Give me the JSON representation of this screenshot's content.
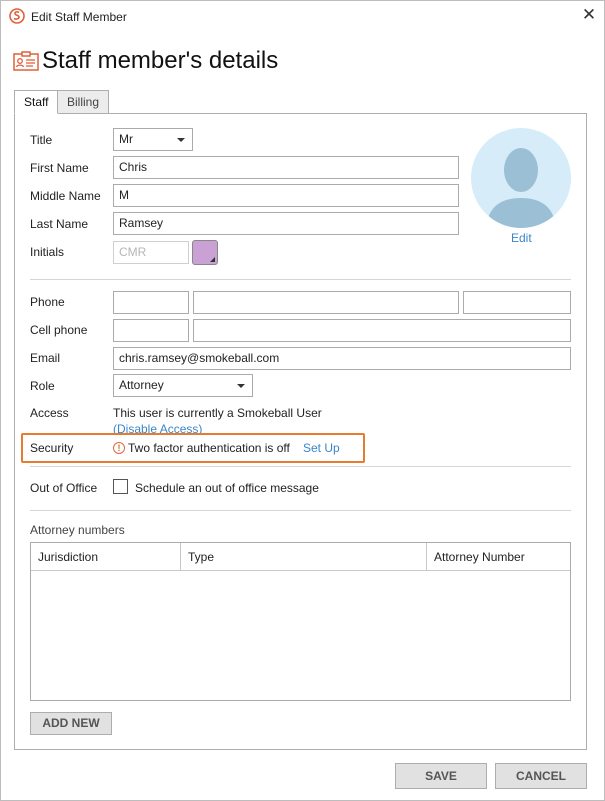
{
  "window": {
    "title": "Edit Staff Member",
    "close_glyph": "✕",
    "app_icon": "smokeball-logo-icon"
  },
  "heading": {
    "text": "Staff member's details",
    "icon": "id-card-icon"
  },
  "tabs": [
    {
      "label": "Staff",
      "active": true
    },
    {
      "label": "Billing",
      "active": false
    }
  ],
  "personal": {
    "title_label": "Title",
    "title_value": "Mr",
    "first_name_label": "First Name",
    "first_name_value": "Chris",
    "middle_name_label": "Middle Name",
    "middle_name_value": "M",
    "last_name_label": "Last Name",
    "last_name_value": "Ramsey",
    "initials_label": "Initials",
    "initials_placeholder": "CMR",
    "initials_color": "#c9a1d4"
  },
  "avatar": {
    "edit_label": "Edit",
    "bg_color": "#d6ecf8",
    "figure_color": "#9bbfd5"
  },
  "contact": {
    "phone_label": "Phone",
    "cell_label": "Cell phone",
    "email_label": "Email",
    "email_value": "chris.ramsey@smokeball.com",
    "role_label": "Role",
    "role_value": "Attorney",
    "access_label": "Access",
    "access_text": "This user is currently a Smokeball User",
    "disable_access_link": "(Disable Access)"
  },
  "security": {
    "label": "Security",
    "warning_glyph": "!",
    "status_text": "Two factor authentication is off",
    "setup_link": "Set Up",
    "highlight_color": "#e67a2e"
  },
  "out_of_office": {
    "label": "Out of Office",
    "checkbox_label": "Schedule an out of office message",
    "checked": false
  },
  "attorney_numbers": {
    "section_label": "Attorney numbers",
    "columns": [
      "Jurisdiction",
      "Type",
      "Attorney Number"
    ],
    "rows": [],
    "add_new_label": "ADD NEW"
  },
  "footer": {
    "save_label": "SAVE",
    "cancel_label": "CANCEL"
  },
  "colors": {
    "accent": "#e67a2e",
    "link": "#3a86c8"
  }
}
